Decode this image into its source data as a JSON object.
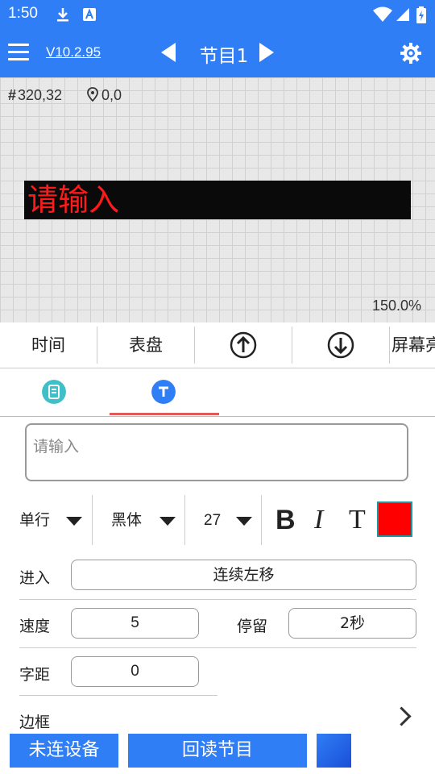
{
  "status_bar": {
    "time": "1:50"
  },
  "app_bar": {
    "version": "V10.2.95",
    "program_title": "节目1"
  },
  "canvas": {
    "size_readout": "320,32",
    "position_readout": "0,0",
    "led_text": "请输入",
    "led_text_color": "#ff1a1a",
    "zoom": "150.0%"
  },
  "toolbar": {
    "items": [
      "时间",
      "表盘",
      "屏幕亮"
    ]
  },
  "editor": {
    "text_placeholder": "请输入",
    "line_mode": "单行",
    "font": "黑体",
    "font_size": "27",
    "color": "#ff0000",
    "enter_label": "进入",
    "enter_value": "连续左移",
    "speed_label": "速度",
    "speed_value": "5",
    "stay_label": "停留",
    "stay_value": "2秒",
    "spacing_label": "字距",
    "spacing_value": "0",
    "border_label": "边框"
  },
  "bottom_bar": {
    "connect_label": "未连设备",
    "readback_label": "回读节目"
  },
  "colors": {
    "accent": "#2f7ef5",
    "tab_underline": "#e05a5a",
    "tab_icon_teal": "#3fc0c8"
  }
}
